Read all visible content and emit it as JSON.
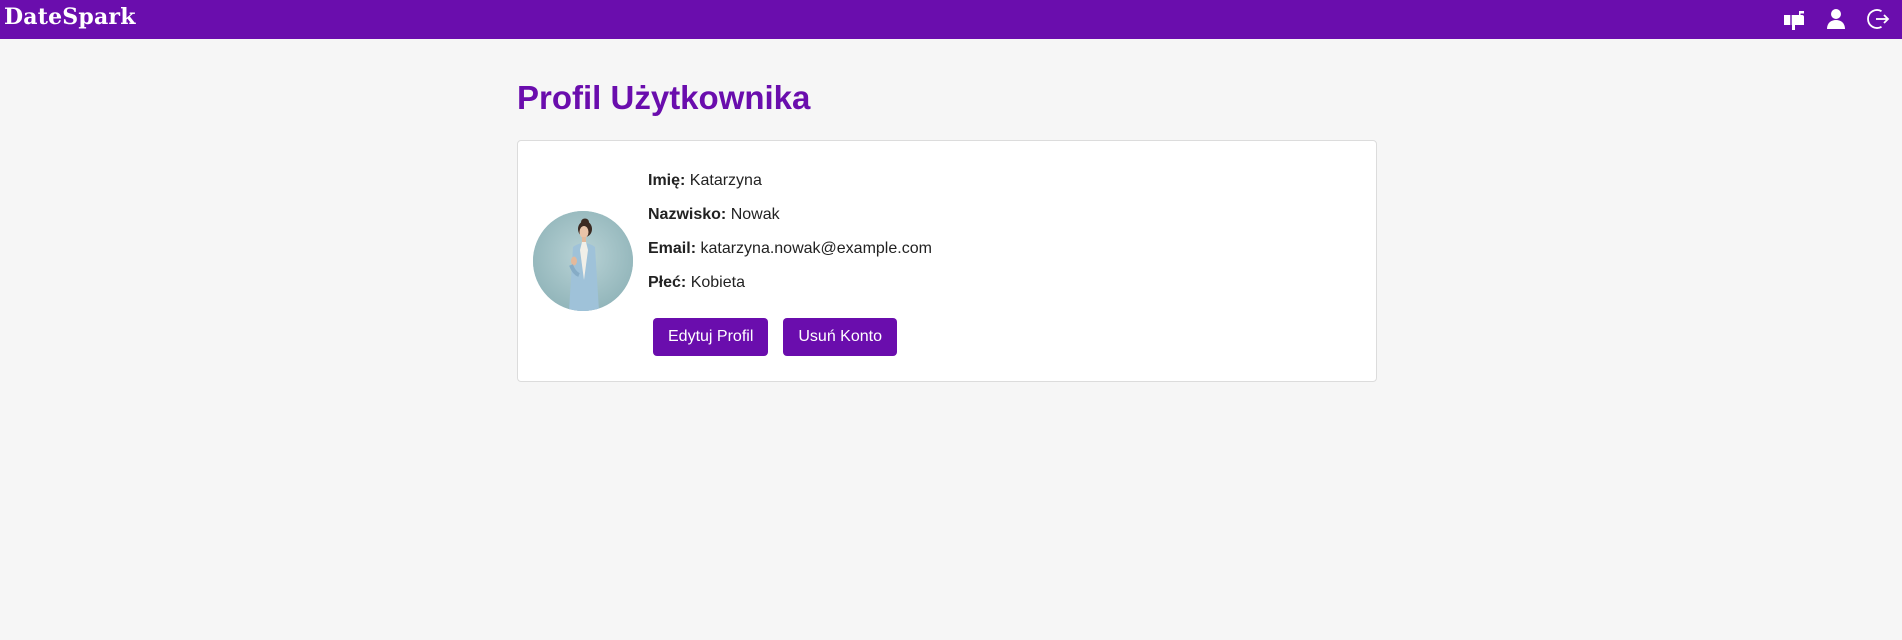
{
  "header": {
    "brand": "DateSpark",
    "icons": [
      "mailbox-icon",
      "user-icon",
      "logout-icon"
    ],
    "background_color": "#6a0dad"
  },
  "profile": {
    "title": "Profil Użytkownika",
    "fields": [
      {
        "label": "Imię:",
        "value": "Katarzyna"
      },
      {
        "label": "Nazwisko:",
        "value": "Nowak"
      },
      {
        "label": "Email:",
        "value": "katarzyna.nowak@example.com"
      },
      {
        "label": "Płeć:",
        "value": "Kobieta"
      }
    ],
    "buttons": {
      "edit": "Edytuj Profil",
      "delete": "Usuń Konto"
    },
    "accent_color": "#6a0dad"
  }
}
